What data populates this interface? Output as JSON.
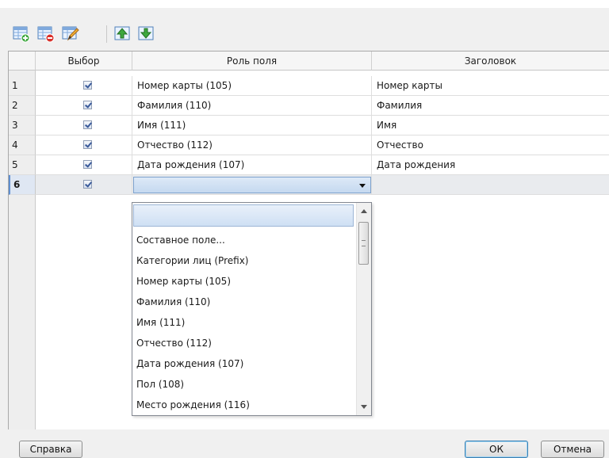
{
  "toolbar": {
    "buttons": [
      {
        "icon": "add-row-icon"
      },
      {
        "icon": "delete-row-icon"
      },
      {
        "icon": "edit-icon"
      },
      {
        "icon": "move-up-icon"
      },
      {
        "icon": "move-down-icon"
      }
    ]
  },
  "grid": {
    "columns": {
      "select": "Выбор",
      "role": "Роль поля",
      "title": "Заголовок"
    },
    "rows": [
      {
        "num": "1",
        "checked": true,
        "role": "Номер карты (105)",
        "title": "Номер карты"
      },
      {
        "num": "2",
        "checked": true,
        "role": "Фамилия (110)",
        "title": "Фамилия"
      },
      {
        "num": "3",
        "checked": true,
        "role": "Имя (111)",
        "title": "Имя"
      },
      {
        "num": "4",
        "checked": true,
        "role": "Отчество (112)",
        "title": "Отчество"
      },
      {
        "num": "5",
        "checked": true,
        "role": "Дата рождения (107)",
        "title": "Дата рождения"
      },
      {
        "num": "6",
        "checked": true,
        "role": "",
        "title": ""
      }
    ]
  },
  "dropdown": {
    "options": [
      "Составное поле...",
      "Категории лиц (Prefix)",
      "Номер карты (105)",
      "Фамилия (110)",
      "Имя (111)",
      "Отчество (112)",
      "Дата рождения (107)",
      "Пол (108)",
      "Место рождения (116)"
    ]
  },
  "buttons": {
    "help": "Справка",
    "ok": "ОК",
    "cancel": "Отмена"
  },
  "colors": {
    "accent": "#3c7fb1",
    "selection": "#cfe0f4"
  }
}
